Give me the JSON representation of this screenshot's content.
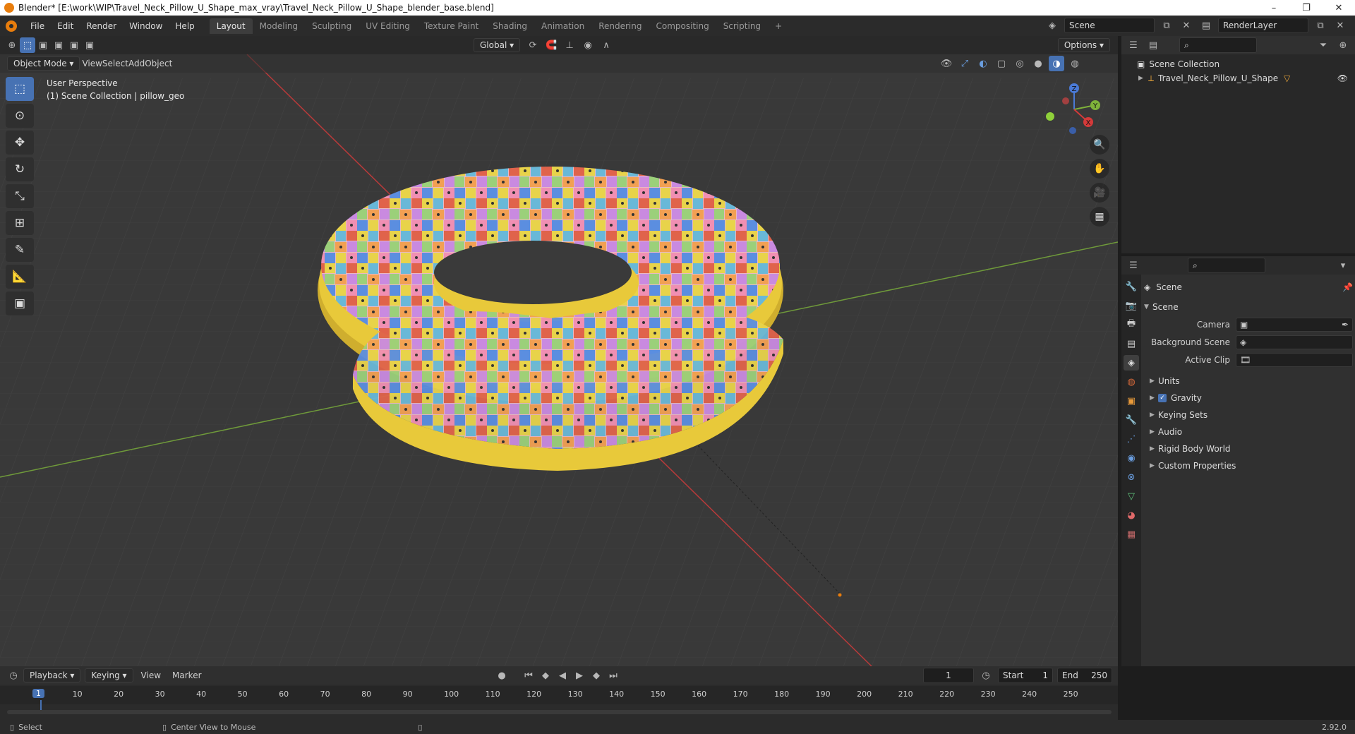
{
  "window": {
    "title": "Blender* [E:\\work\\WIP\\Travel_Neck_Pillow_U_Shape_max_vray\\Travel_Neck_Pillow_U_Shape_blender_base.blend]",
    "minimize": "–",
    "maximize": "❐",
    "close": "✕"
  },
  "menu": [
    "File",
    "Edit",
    "Render",
    "Window",
    "Help"
  ],
  "workspaces": [
    "Layout",
    "Modeling",
    "Sculpting",
    "UV Editing",
    "Texture Paint",
    "Shading",
    "Animation",
    "Rendering",
    "Compositing",
    "Scripting"
  ],
  "active_workspace": "Layout",
  "add_workspace": "+",
  "scene_field": "Scene",
  "renderlayer_field": "RenderLayer",
  "viewport": {
    "mode": "Object Mode",
    "menus": [
      "View",
      "Select",
      "Add",
      "Object"
    ],
    "orientation": "Global",
    "options": "Options",
    "overlay_line1": "User Perspective",
    "overlay_line2": "(1) Scene Collection | pillow_geo",
    "gizmo": {
      "x": "X",
      "y": "Y",
      "z": "Z"
    }
  },
  "outliner": {
    "root": "Scene Collection",
    "items": [
      {
        "label": "Travel_Neck_Pillow_U_Shape"
      }
    ]
  },
  "properties": {
    "header": "Scene",
    "panel": "Scene",
    "fields": [
      {
        "label": "Camera",
        "value": ""
      },
      {
        "label": "Background Scene",
        "value": ""
      },
      {
        "label": "Active Clip",
        "value": ""
      }
    ],
    "sections": [
      {
        "label": "Units"
      },
      {
        "label": "Gravity",
        "checkbox": true
      },
      {
        "label": "Keying Sets"
      },
      {
        "label": "Audio"
      },
      {
        "label": "Rigid Body World"
      },
      {
        "label": "Custom Properties"
      }
    ]
  },
  "timeline": {
    "menus": [
      "Playback",
      "Keying",
      "View",
      "Marker"
    ],
    "current_frame": "1",
    "start_label": "Start",
    "start": "1",
    "end_label": "End",
    "end": "250",
    "ticks": [
      "10",
      "20",
      "30",
      "40",
      "50",
      "60",
      "70",
      "80",
      "90",
      "100",
      "110",
      "120",
      "130",
      "140",
      "150",
      "160",
      "170",
      "180",
      "190",
      "200",
      "210",
      "220",
      "230",
      "240",
      "250"
    ],
    "playhead": "1"
  },
  "status": {
    "left": "Select",
    "middle": "Center View to Mouse",
    "version": "2.92.0"
  },
  "colors": {
    "accent": "#4772b3",
    "orange": "#e87d0d",
    "pillow_yellow": "#e8c93a",
    "x_axis": "#d43a3a",
    "y_axis": "#7fb23a"
  }
}
